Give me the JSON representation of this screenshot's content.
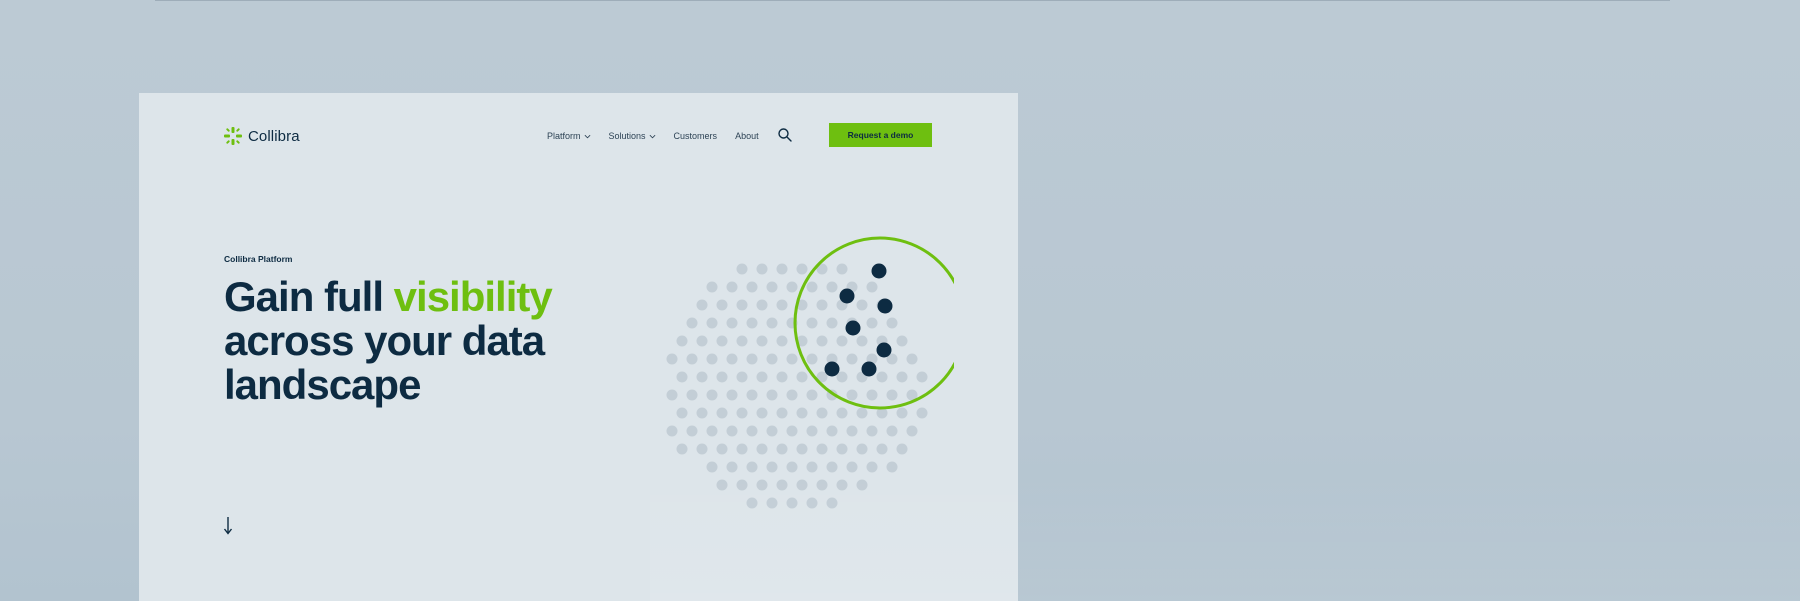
{
  "brand": {
    "name": "Collibra",
    "accent": "#6ebf10",
    "ink": "#0d2b42"
  },
  "nav": {
    "items": [
      {
        "label": "Platform",
        "has_dropdown": true
      },
      {
        "label": "Solutions",
        "has_dropdown": true
      },
      {
        "label": "Customers",
        "has_dropdown": false
      },
      {
        "label": "About",
        "has_dropdown": false
      }
    ],
    "search_icon": "search-icon",
    "cta_label": "Request a demo"
  },
  "hero": {
    "eyebrow": "Collibra Platform",
    "headline_part1": "Gain full ",
    "headline_accent": "visibility",
    "headline_part2": " across your data landscape",
    "scroll_icon": "arrow-down-icon"
  },
  "illustration": {
    "name": "dot-sphere-with-magnifier",
    "dot_color": "#c3ced6",
    "highlight_color": "#0d2b42",
    "ring_color": "#6ebf10"
  }
}
